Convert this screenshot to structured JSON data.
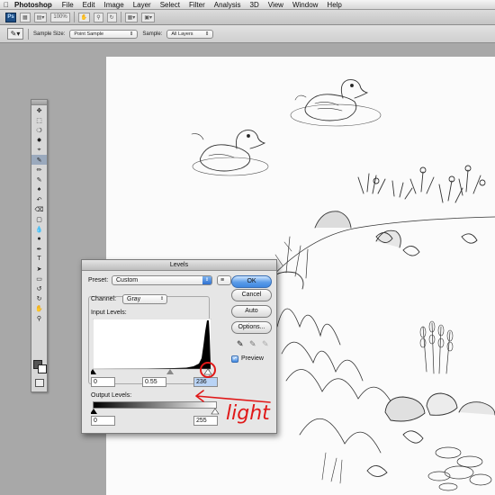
{
  "menubar": {
    "app_name": "Photoshop",
    "items": [
      "File",
      "Edit",
      "Image",
      "Layer",
      "Select",
      "Filter",
      "Analysis",
      "3D",
      "View",
      "Window",
      "Help"
    ]
  },
  "appbar": {
    "zoom": "100%"
  },
  "options": {
    "sample_size_label": "Sample Size:",
    "sample_size_value": "Point Sample",
    "sample_label": "Sample:",
    "sample_value": "All Layers"
  },
  "levels": {
    "title": "Levels",
    "preset_label": "Preset:",
    "preset_value": "Custom",
    "channel_label": "Channel:",
    "channel_value": "Gray",
    "input_levels_label": "Input Levels:",
    "input_black": "0",
    "input_gamma": "0.55",
    "input_white": "236",
    "output_levels_label": "Output Levels:",
    "output_black": "0",
    "output_white": "255",
    "buttons": {
      "ok": "OK",
      "cancel": "Cancel",
      "auto": "Auto",
      "options": "Options..."
    },
    "preview_label": "Preview",
    "preview_checked": true
  },
  "annotation": {
    "text": "light",
    "color": "#e01818"
  },
  "colors": {
    "accent": "#3f87e0",
    "annotation_red": "#e01818"
  }
}
